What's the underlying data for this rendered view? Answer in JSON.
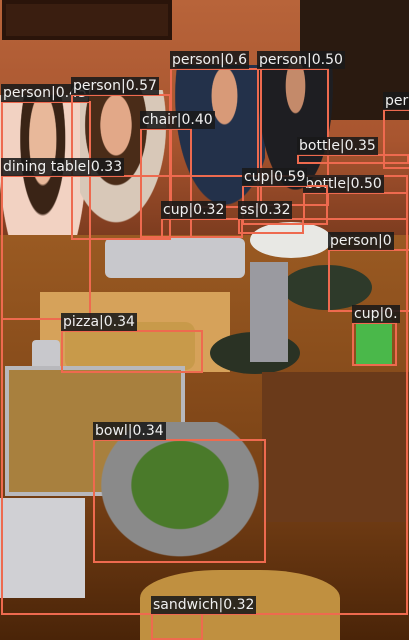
{
  "detections": [
    {
      "id": "person-1",
      "label": "person|0.45"
    },
    {
      "id": "person-2",
      "label": "person|0.57"
    },
    {
      "id": "person-3",
      "label": "person|0.6"
    },
    {
      "id": "person-4",
      "label": "person|0.50"
    },
    {
      "id": "person-5",
      "label": "per"
    },
    {
      "id": "person-6",
      "label": "person|0"
    },
    {
      "id": "chair-1",
      "label": "chair|0.40"
    },
    {
      "id": "dining-table-1",
      "label": "dining table|0.33"
    },
    {
      "id": "bottle-1",
      "label": "bottle|0.35"
    },
    {
      "id": "bottle-2",
      "label": "bottle|0.50"
    },
    {
      "id": "cup-1",
      "label": "cup|0.59"
    },
    {
      "id": "cup-2",
      "label": "cup|0.32"
    },
    {
      "id": "glass-1",
      "label": "ss|0.32"
    },
    {
      "id": "cup-3",
      "label": "cup|0."
    },
    {
      "id": "pizza-1",
      "label": "pizza|0.34"
    },
    {
      "id": "bowl-1",
      "label": "bowl|0.34"
    },
    {
      "id": "sandwich-1",
      "label": "sandwich|0.32"
    }
  ]
}
